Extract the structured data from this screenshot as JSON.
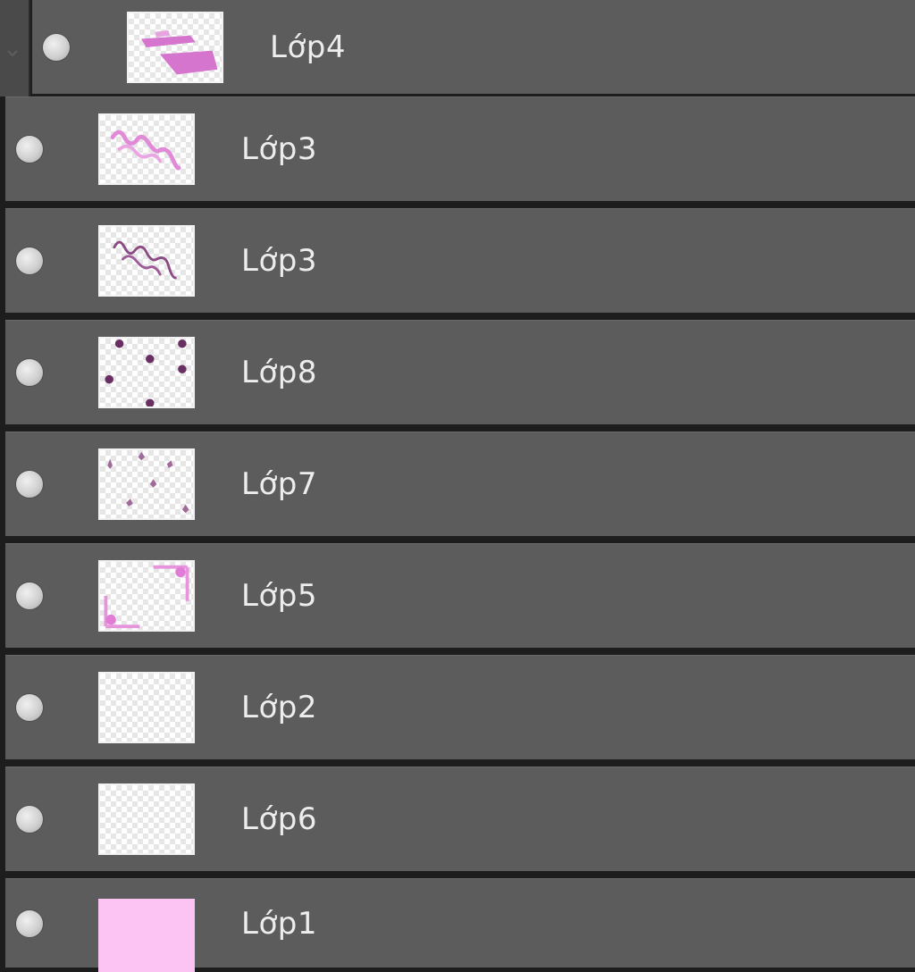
{
  "layers_panel": {
    "layers": [
      {
        "name": "Lớp4",
        "thumbnail_icon": "pink-strokes-thumbnail"
      },
      {
        "name": "Lớp3",
        "thumbnail_icon": "pink-scribble-thumbnail"
      },
      {
        "name": "Lớp3",
        "thumbnail_icon": "purple-scribble-thumbnail"
      },
      {
        "name": "Lớp8",
        "thumbnail_icon": "dark-dots-thumbnail"
      },
      {
        "name": "Lớp7",
        "thumbnail_icon": "sparkles-thumbnail"
      },
      {
        "name": "Lớp5",
        "thumbnail_icon": "pink-frame-thumbnail"
      },
      {
        "name": "Lớp2",
        "thumbnail_icon": "empty-thumbnail"
      },
      {
        "name": "Lớp6",
        "thumbnail_icon": "empty-thumbnail"
      },
      {
        "name": "Lớp1",
        "thumbnail_icon": "pink-fill-thumbnail"
      }
    ],
    "colors": {
      "row_bg": "#5c5c5c",
      "separator": "#1e1e1e",
      "label_text": "#ededed",
      "fill_pink": "#fbc4f2",
      "stroke_magenta": "#d470cc",
      "dot_purple": "#6a2f62"
    }
  }
}
